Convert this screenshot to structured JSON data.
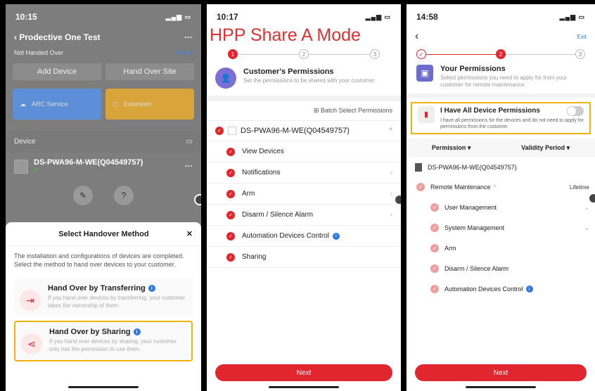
{
  "overlay_title": "HPP Share A Mode",
  "phone1": {
    "time": "10:15",
    "title": "Prodective One Test",
    "status_left": "Not Handed Over",
    "detail": "Detail",
    "add_device": "Add Device",
    "hand_over_site": "Hand Over Site",
    "tile_arc": "ARC Service",
    "tile_ext": "Extension",
    "device_header": "Device",
    "device_name": "DS-PWA96-M-WE(Q04549757)",
    "sheet_title": "Select Handover Method",
    "sheet_desc": "The installation and configurations of devices are completed. Select the method to hand over devices to your customer.",
    "opt1_title": "Hand Over by Transferring",
    "opt1_desc": "If you hand over devices by transferring, your customer takes the ownership of them.",
    "opt2_title": "Hand Over by Sharing",
    "opt2_desc": "If you hand over devices by sharing, your customer only has the permission to use them."
  },
  "phone2": {
    "time": "10:17",
    "steps": [
      "1",
      "2",
      "3"
    ],
    "title": "Customer's Permissions",
    "desc": "Set the permissions to be shared with your customer.",
    "batch": "Batch Select Permissions",
    "device": "DS-PWA96-M-WE(Q04549757)",
    "permissions": [
      "View Devices",
      "Notifications",
      "Arm",
      "Disarm / Silence Alarm",
      "Automation Devices Control",
      "Sharing"
    ],
    "next": "Next"
  },
  "phone3": {
    "time": "14:58",
    "exit": "Exit",
    "steps": [
      "2",
      "3"
    ],
    "title": "Your Permissions",
    "desc": "Select permissions you need to apply for from your customer for remote maintenance.",
    "all_title": "I Have All Device Permissions",
    "all_desc": "I have all permissions for the devices and do not need to apply for permissions from the customer.",
    "filter_permission": "Permission",
    "filter_validity": "Validity Period",
    "device": "DS-PWA96-M-WE(Q04549757)",
    "remote": "Remote Maintenance",
    "lifetime": "Lifetime",
    "permissions": [
      "User Management",
      "System Management",
      "Arm",
      "Disarm / Silence Alarm",
      "Automation Devices Control"
    ],
    "next": "Next"
  }
}
